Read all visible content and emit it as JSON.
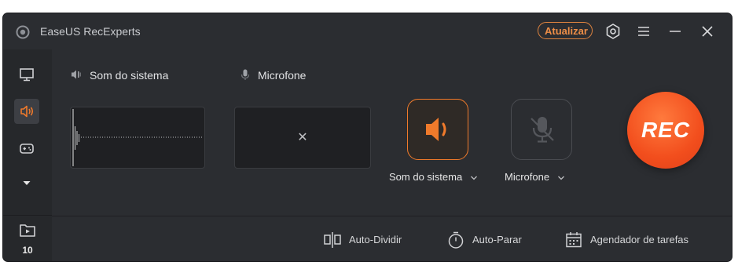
{
  "app": {
    "title": "EaseUS RecExperts"
  },
  "titlebar": {
    "upgrade_label": "Atualizar"
  },
  "sidebar": {
    "items": [
      {
        "name": "screen",
        "icon": "monitor-icon"
      },
      {
        "name": "audio",
        "icon": "speaker-icon",
        "active": true
      },
      {
        "name": "game",
        "icon": "gamepad-icon"
      },
      {
        "name": "more",
        "icon": "triangle-down-icon"
      }
    ],
    "recordings": {
      "icon": "folder-play-icon",
      "count": "10"
    }
  },
  "sources": {
    "system_sound": {
      "label": "Som do sistema",
      "icon": "speaker-icon"
    },
    "microphone": {
      "label": "Microfone",
      "icon": "microphone-icon",
      "empty_mark": "✕"
    }
  },
  "controls": {
    "system_sound": {
      "label": "Som do sistema",
      "state": "on",
      "accent": "#f07a2b"
    },
    "microphone": {
      "label": "Microfone",
      "state": "muted"
    },
    "record": {
      "label": "REC",
      "color": "#f24e1d"
    }
  },
  "bottom": {
    "auto_split": "Auto-Dividir",
    "auto_stop": "Auto-Parar",
    "scheduler": "Agendador de tarefas"
  }
}
